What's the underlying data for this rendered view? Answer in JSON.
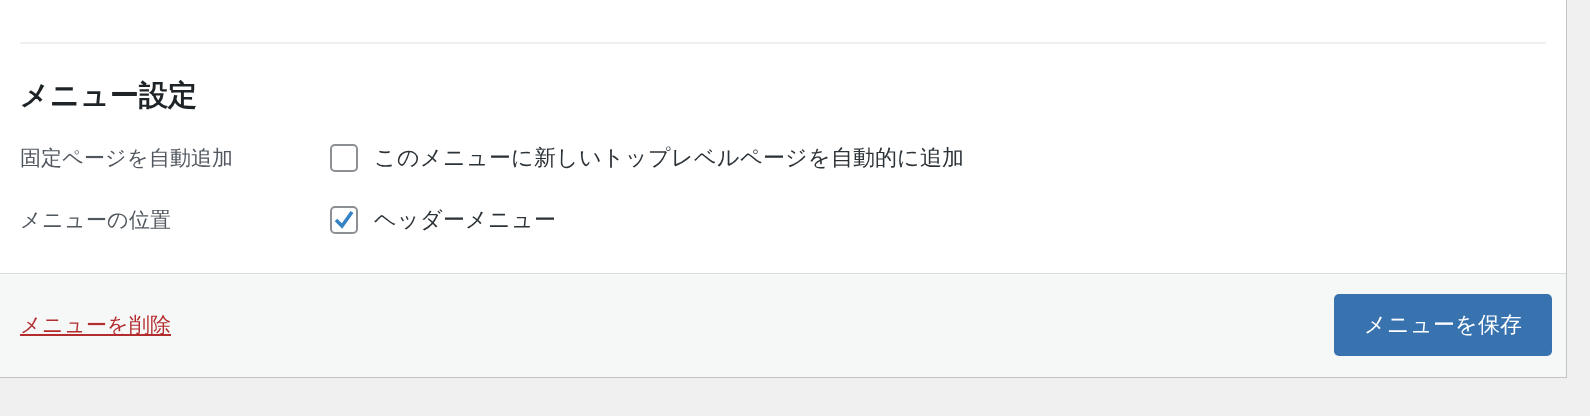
{
  "section": {
    "title": "メニュー設定"
  },
  "settings": [
    {
      "label": "固定ページを自動追加",
      "option": "このメニューに新しいトップレベルページを自動的に追加",
      "checked": false
    },
    {
      "label": "メニューの位置",
      "option": "ヘッダーメニュー",
      "checked": true
    }
  ],
  "footer": {
    "delete_link": "メニューを削除",
    "save_button": "メニューを保存"
  }
}
